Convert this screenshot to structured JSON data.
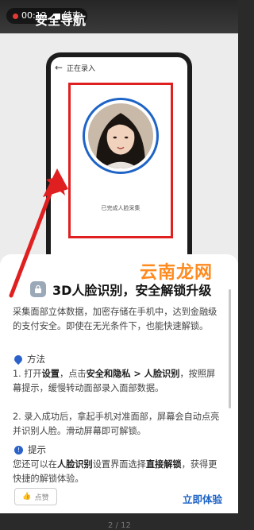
{
  "recording": {
    "time": "00:12",
    "stop_label": "结束"
  },
  "header": {
    "title": "安全导航"
  },
  "phone": {
    "header_title": "正在录入",
    "face_caption": "已完成人脸采集"
  },
  "card": {
    "title": "3D人脸识别，安全解锁升级",
    "description": "采集面部立体数据，加密存储在手机中，达到金融级的支付安全。即使在无光条件下，也能快速解锁。",
    "method_label": "方法",
    "step1_a": "1. 打开",
    "step1_b": "设置",
    "step1_c": "，点击",
    "step1_d": "安全和隐私 > 人脸识别",
    "step1_e": "，按照屏幕提示，缓慢转动面部录入面部数据。",
    "step2": "2. 录入成功后，拿起手机对准面部，屏幕会自动点亮并识别人脸。滑动屏幕即可解锁。",
    "tip_label": "提示",
    "tip_a": "您还可以在",
    "tip_b": "人脸识别",
    "tip_c": "设置界面选择",
    "tip_d": "直接解锁",
    "tip_e": "，获得更快捷的解锁体验。",
    "like_label": "点赞",
    "try_label": "立即体验",
    "pager": "2 / 12"
  },
  "watermark": "云南龙网",
  "colors": {
    "accent": "#1e63c6",
    "highlight": "#e02020",
    "watermark": "#ff8a1e"
  }
}
